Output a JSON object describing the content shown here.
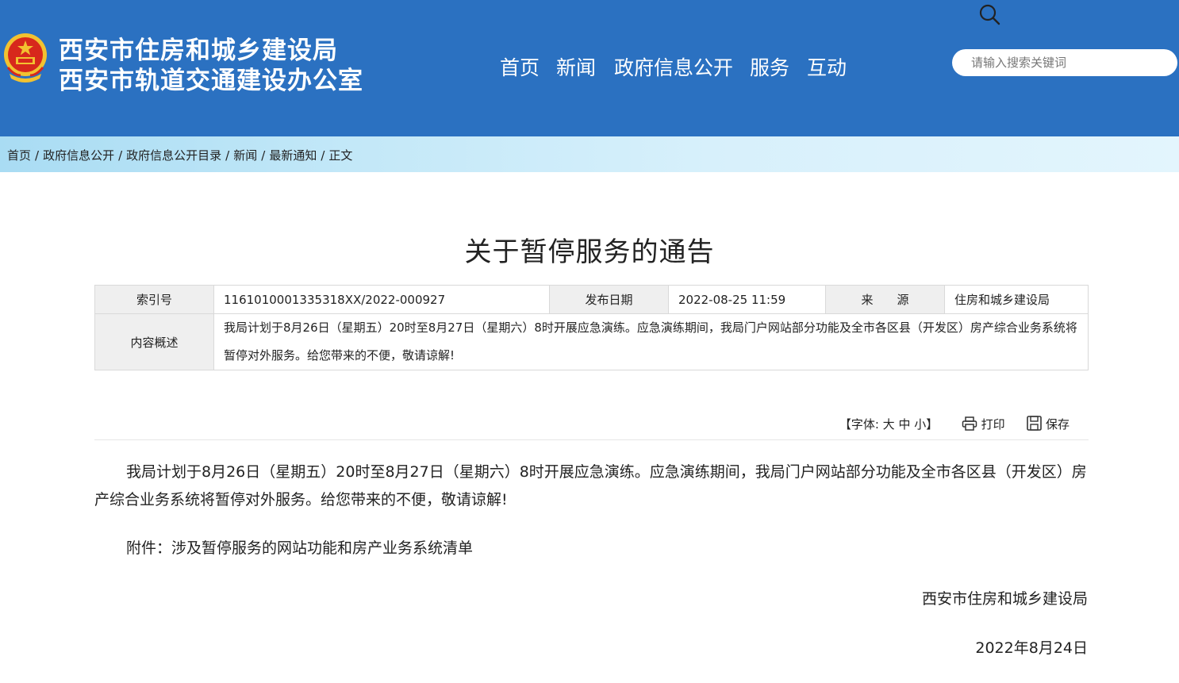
{
  "header": {
    "org_line1": "西安市住房和城乡建设局",
    "org_line2": "西安市轨道交通建设办公室",
    "emblem_icon": "national-emblem-icon",
    "nav": [
      "首页",
      "新闻",
      "政府信息公开",
      "服务",
      "互动"
    ],
    "search_placeholder": "请输入搜索关键词",
    "colors": {
      "header_bg": "#2b71c1",
      "emblem_red": "#d7281c",
      "emblem_gold": "#f2c230"
    }
  },
  "breadcrumb": [
    "首页",
    "政府信息公开",
    "政府信息公开目录",
    "新闻",
    "最新通知",
    "正文"
  ],
  "article": {
    "title": "关于暂停服务的通告",
    "meta": {
      "index_label": "索引号",
      "index_value": "1161010001335318XX/2022-000927",
      "date_label": "发布日期",
      "date_value": "2022-08-25 11:59",
      "source_label": "来　　源",
      "source_value": "住房和城乡建设局",
      "summary_label": "内容概述",
      "summary_value": "我局计划于8月26日（星期五）20时至8月27日（星期六）8时开展应急演练。应急演练期间，我局门户网站部分功能及全市各区县（开发区）房产综合业务系统将暂停对外服务。给您带来的不便，敬请谅解!"
    },
    "tools": {
      "font_prefix": "【字体:",
      "font_large": "大",
      "font_medium": "中",
      "font_small": "小",
      "font_suffix": "】",
      "print": "打印",
      "save": "保存"
    },
    "body": "我局计划于8月26日（星期五）20时至8月27日（星期六）8时开展应急演练。应急演练期间，我局门户网站部分功能及全市各区县（开发区）房产综合业务系统将暂停对外服务。给您带来的不便，敬请谅解!",
    "attachment": "附件：涉及暂停服务的网站功能和房产业务系统清单",
    "signature": "西安市住房和城乡建设局",
    "sign_date": "2022年8月24日"
  }
}
